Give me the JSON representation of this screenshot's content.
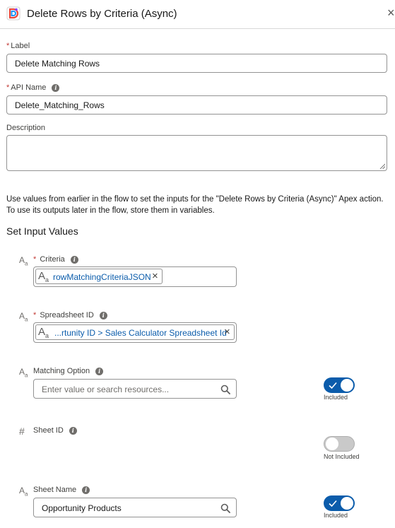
{
  "header": {
    "title": "Delete Rows by Criteria (Async)",
    "close_symbol": "×",
    "logo_icon": "app-logo-icon"
  },
  "form": {
    "label": {
      "label": "Label",
      "required_mark": "*",
      "value": "Delete Matching Rows"
    },
    "api_name": {
      "label": "API Name",
      "required_mark": "*",
      "value": "Delete_Matching_Rows"
    },
    "description": {
      "label": "Description",
      "value": ""
    }
  },
  "help_text": {
    "line1": "Use values from earlier in the flow to set the inputs for the \"Delete Rows by Criteria (Async)\" Apex action.",
    "line2": "To use its outputs later in the flow, store them in variables."
  },
  "section_title": "Set Input Values",
  "inputs": {
    "criteria": {
      "label": "Criteria",
      "required_mark": "*",
      "type_icon": "text-type-icon",
      "pill_text": "rowMatchingCriteriaJSON"
    },
    "spreadsheet_id": {
      "label": "Spreadsheet ID",
      "required_mark": "*",
      "type_icon": "text-type-icon",
      "pill_text": "...rtunity ID > Sales Calculator Spreadsheet Id"
    },
    "matching_option": {
      "label": "Matching Option",
      "type_icon": "text-type-icon",
      "placeholder": "Enter value or search resources...",
      "toggle_label": "Included",
      "included": true
    },
    "sheet_id": {
      "label": "Sheet ID",
      "type_icon": "number-type-icon",
      "toggle_label": "Not Included",
      "included": false
    },
    "sheet_name": {
      "label": "Sheet Name",
      "type_icon": "text-type-icon",
      "value": "Opportunity Products",
      "toggle_label": "Included",
      "included": true
    }
  },
  "symbols": {
    "info": "i",
    "text_type_a": "A",
    "text_type_sub": "a",
    "number_type": "#",
    "remove": "×"
  },
  "colors": {
    "accent": "#0b5cab",
    "required": "#c23934",
    "border": "#939393"
  }
}
